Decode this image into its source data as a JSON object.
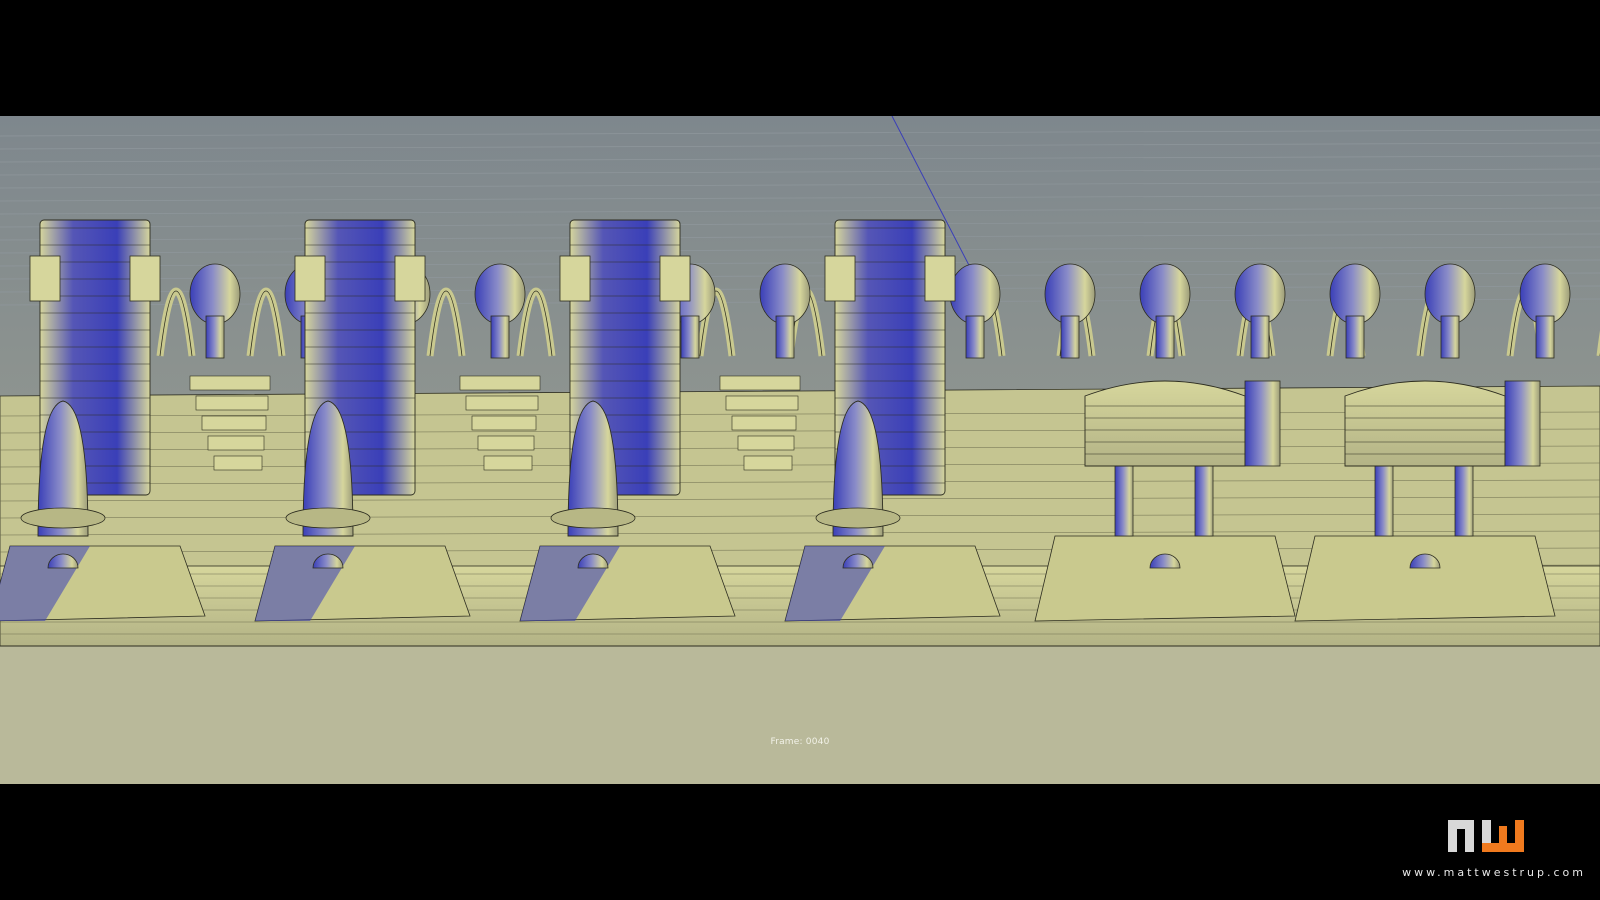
{
  "viewport": {
    "frame_label": "Frame: 0040",
    "colors": {
      "background_top": "#7e878d",
      "background_bottom": "#a2a593",
      "mesh_fill": "#d6d69c",
      "mesh_shadow": "#3a3fb8",
      "wire": "#2d2d20",
      "floor": "#b9b99a"
    }
  },
  "branding": {
    "logo_text": "mw",
    "url": "www.mattwestrup.com",
    "logo_accent_color": "#f07a1e",
    "logo_color": "#d8d8d8"
  }
}
